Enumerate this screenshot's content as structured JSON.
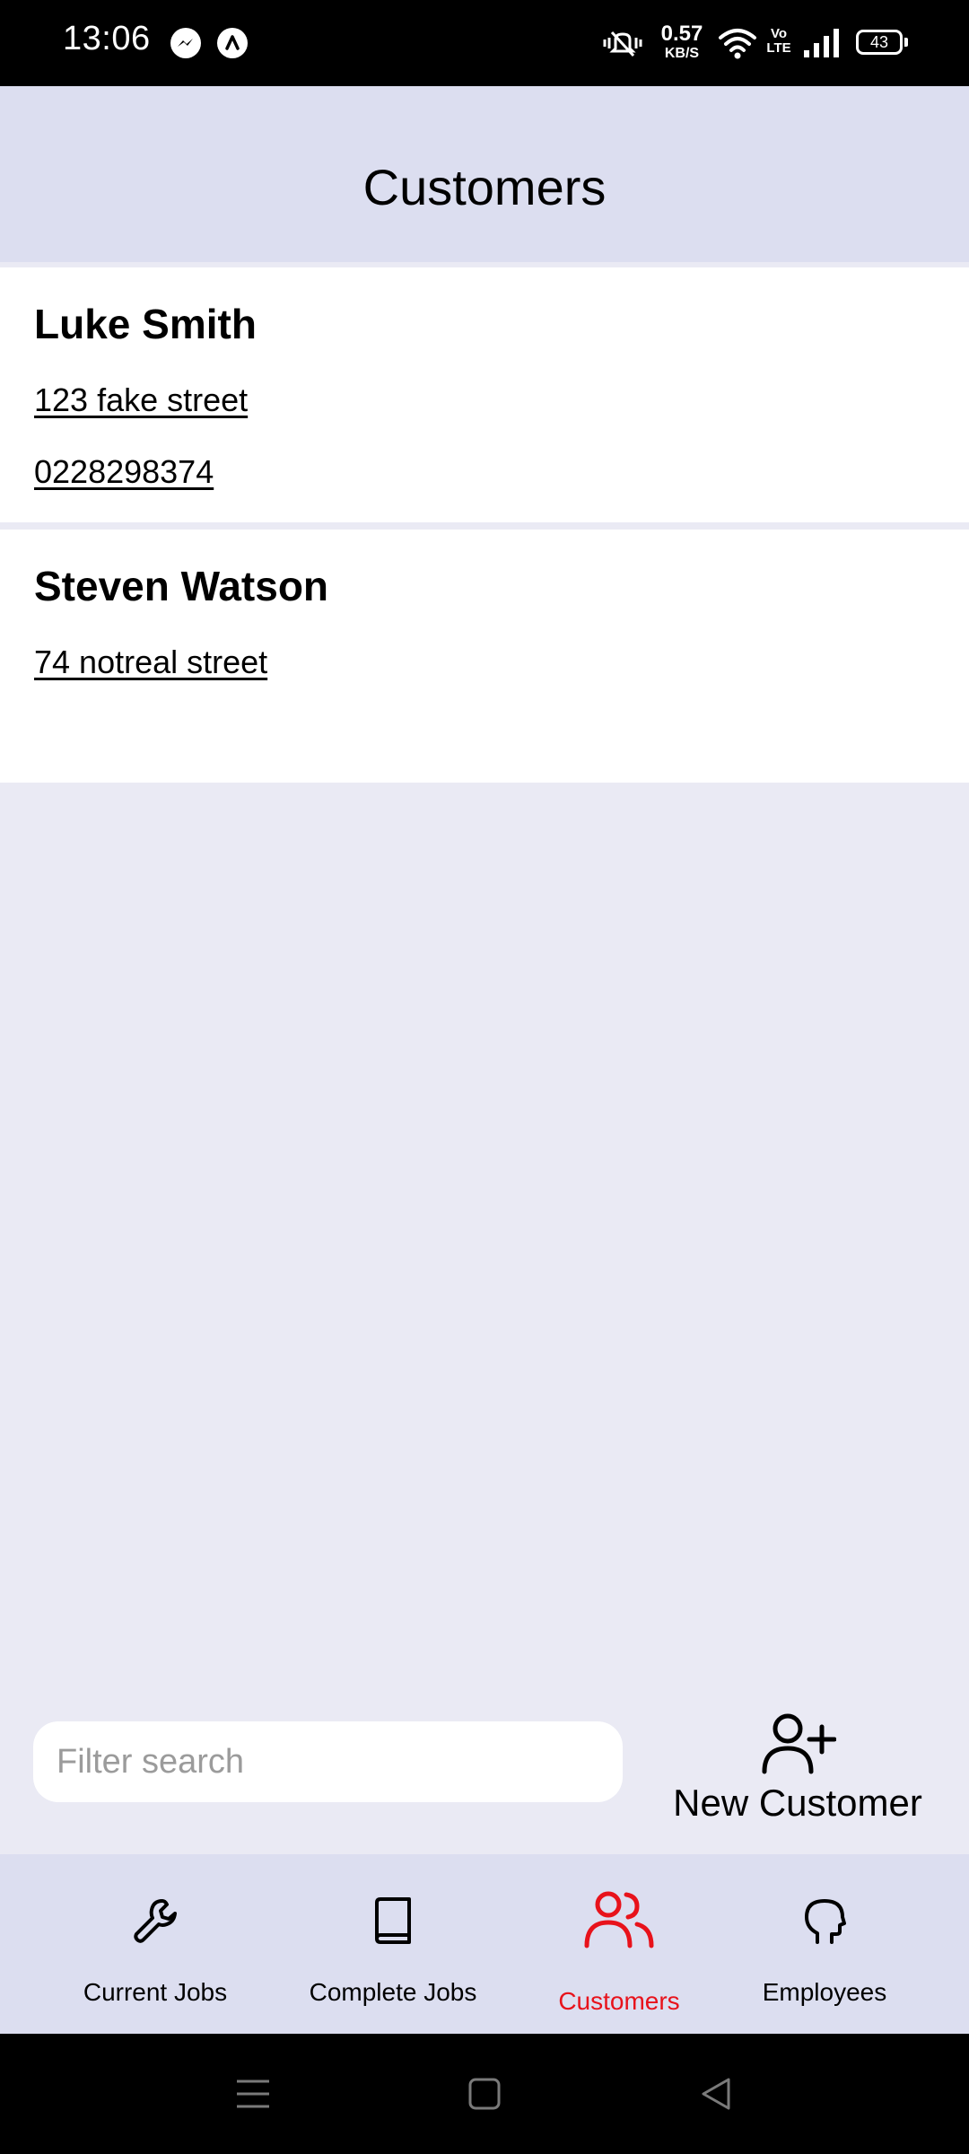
{
  "status_bar": {
    "time": "13:06",
    "network_speed_value": "0.57",
    "network_speed_unit": "KB/S",
    "volte_label": "Vo LTE",
    "battery_level": "43",
    "icons": [
      "messenger-icon",
      "app-icon",
      "vibrate-off-icon",
      "wifi-icon",
      "volte-icon",
      "signal-icon",
      "battery-icon"
    ]
  },
  "header": {
    "title": "Customers"
  },
  "customers": [
    {
      "name": "Luke Smith",
      "address": "123 fake street",
      "phone": "0228298374"
    },
    {
      "name": "Steven Watson",
      "address": "74 notreal street"
    }
  ],
  "search": {
    "placeholder": "Filter search",
    "value": ""
  },
  "actions": {
    "new_customer_label": "New Customer",
    "new_customer_icon": "user-plus-icon"
  },
  "nav": {
    "items": [
      {
        "label": "Current Jobs",
        "icon": "wrench-icon",
        "active": false
      },
      {
        "label": "Complete Jobs",
        "icon": "book-icon",
        "active": false
      },
      {
        "label": "Customers",
        "icon": "users-icon",
        "active": true
      },
      {
        "label": "Employees",
        "icon": "head-icon",
        "active": false
      }
    ]
  },
  "system_nav": {
    "buttons": [
      "menu-icon",
      "home-icon",
      "back-icon"
    ]
  },
  "colors": {
    "header_bg": "#DCDEF0",
    "page_bg": "#EAEAF4",
    "active_accent": "#E8121B",
    "card_bg": "#FFFFFF",
    "status_bar_bg": "#000000"
  }
}
